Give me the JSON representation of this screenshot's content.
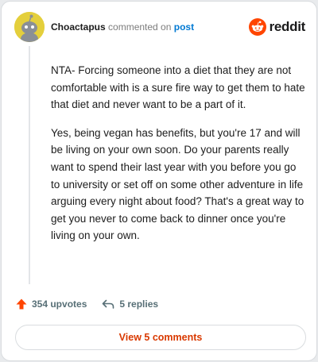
{
  "comment": {
    "username": "Choactapus",
    "action_text": "commented on",
    "target_text": "post",
    "paragraphs": [
      "NTA- Forcing someone into a diet that they are not comfortable with is a sure fire way to get them to hate that diet and never want to be a part of it.",
      "Yes, being vegan has benefits, but you're 17 and will be living on your own soon. Do your parents really want to spend their last year with you before you go to university or set off on some other adventure in life arguing every night about food? That's a great way to get you never to come back to dinner once you're living on your own."
    ],
    "upvotes": "354 upvotes",
    "replies": "5 replies"
  },
  "brand": {
    "name": "reddit",
    "color": "#ff4500",
    "icon": "reddit-snoo-icon"
  },
  "view_button": {
    "label": "View 5 comments",
    "color": "#d93900"
  },
  "icons": {
    "upvote": "upvote-arrow-icon",
    "reply": "reply-arrow-icon",
    "avatar": "snoo-avatar"
  }
}
